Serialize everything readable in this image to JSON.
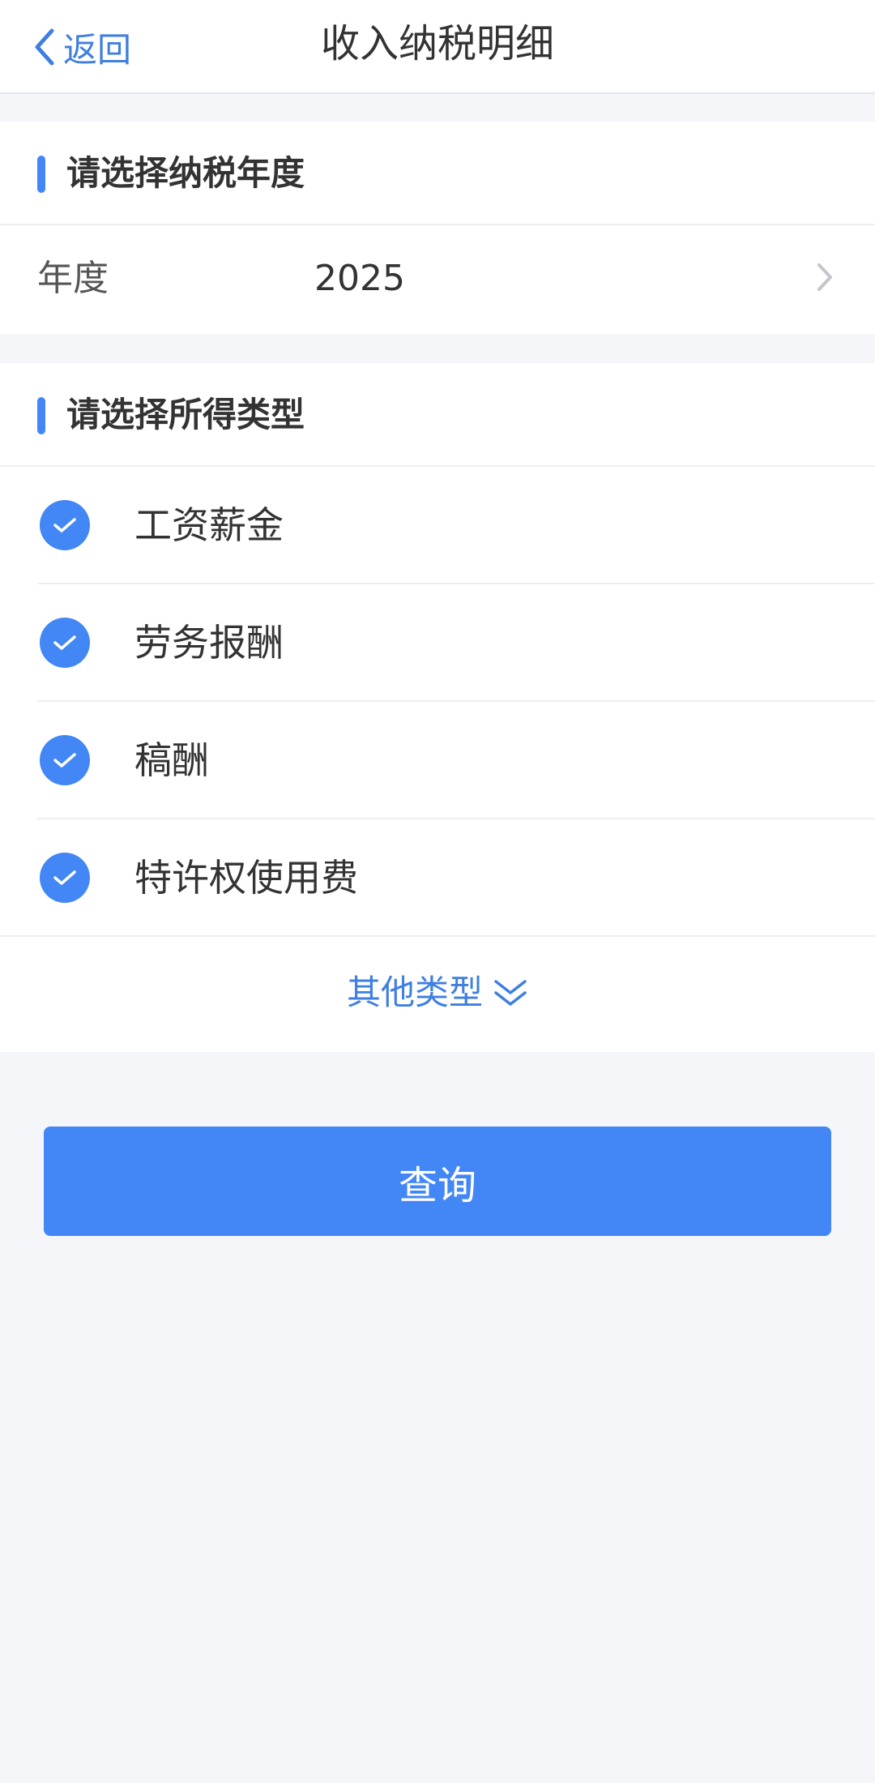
{
  "colors": {
    "accent": "#4287f5",
    "link": "#3f7fe0"
  },
  "header": {
    "back_label": "返回",
    "back_icon": "chevron-left-icon",
    "title": "收入纳税明细"
  },
  "year_section": {
    "title": "请选择纳税年度",
    "row_label": "年度",
    "row_value": "2025",
    "row_icon": "chevron-right-icon"
  },
  "income_section": {
    "title": "请选择所得类型",
    "options": [
      {
        "label": "工资薪金",
        "checked": true
      },
      {
        "label": "劳务报酬",
        "checked": true
      },
      {
        "label": "稿酬",
        "checked": true
      },
      {
        "label": "特许权使用费",
        "checked": true
      }
    ],
    "check_icon": "check-icon",
    "more_label": "其他类型",
    "more_icon": "double-chevron-down-icon"
  },
  "query_button": {
    "label": "查询"
  }
}
